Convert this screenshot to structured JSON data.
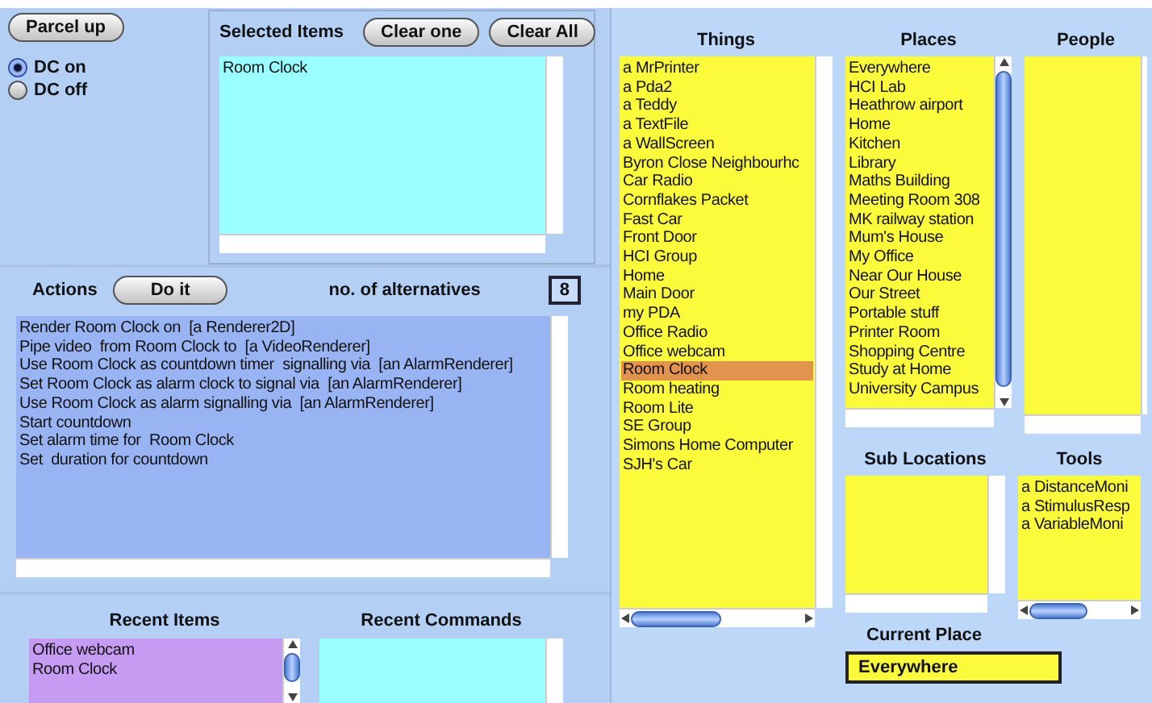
{
  "toolbar": {
    "parcel_button": "Parcel up",
    "dc_options": [
      {
        "label": "DC on",
        "selected": true
      },
      {
        "label": "DC off",
        "selected": false
      }
    ]
  },
  "selected_items": {
    "title": "Selected Items",
    "buttons": [
      "Clear one",
      "Clear All"
    ],
    "items": [
      {
        "label": "Room Clock",
        "selected": false
      }
    ]
  },
  "actions": {
    "title": "Actions",
    "do_button": "Do it",
    "alternatives_label": "no. of alternatives",
    "alternatives_count": "8",
    "items": [
      {
        "label": "Render Room Clock on  [a Renderer2D]",
        "selected": false
      },
      {
        "label": "Pipe video  from Room Clock to  [a VideoRenderer]",
        "selected": false
      },
      {
        "label": "Use Room Clock as countdown timer  signalling via  [an AlarmRenderer]",
        "selected": false
      },
      {
        "label": "Set Room Clock as alarm clock to signal via  [an AlarmRenderer]",
        "selected": false
      },
      {
        "label": "Use Room Clock as alarm signalling via  [an AlarmRenderer]",
        "selected": false
      },
      {
        "label": "Start countdown",
        "selected": false
      },
      {
        "label": "Set alarm time for  Room Clock",
        "selected": false
      },
      {
        "label": "Set  duration for countdown",
        "selected": false
      }
    ]
  },
  "recent_items": {
    "title": "Recent Items",
    "items": [
      {
        "label": "Office webcam",
        "selected": false
      },
      {
        "label": "Room Clock",
        "selected": false
      }
    ]
  },
  "recent_commands": {
    "title": "Recent Commands"
  },
  "things": {
    "title": "Things",
    "items": [
      {
        "label": "a MrPrinter",
        "selected": false
      },
      {
        "label": "a Pda2",
        "selected": false
      },
      {
        "label": "a Teddy",
        "selected": false
      },
      {
        "label": "a TextFile",
        "selected": false
      },
      {
        "label": "a WallScreen",
        "selected": false
      },
      {
        "label": "Byron Close Neighbourhc",
        "selected": false
      },
      {
        "label": "Car Radio",
        "selected": false
      },
      {
        "label": "Cornflakes Packet",
        "selected": false
      },
      {
        "label": "Fast Car",
        "selected": false
      },
      {
        "label": "Front Door",
        "selected": false
      },
      {
        "label": "HCI Group",
        "selected": false
      },
      {
        "label": "Home",
        "selected": false
      },
      {
        "label": "Main Door",
        "selected": false
      },
      {
        "label": "my PDA",
        "selected": false
      },
      {
        "label": "Office Radio",
        "selected": false
      },
      {
        "label": "Office webcam",
        "selected": false
      },
      {
        "label": "Room Clock",
        "selected": true
      },
      {
        "label": "Room heating",
        "selected": false
      },
      {
        "label": "Room Lite",
        "selected": false
      },
      {
        "label": "SE Group",
        "selected": false
      },
      {
        "label": "Simons Home Computer",
        "selected": false
      },
      {
        "label": "SJH's Car",
        "selected": false
      }
    ]
  },
  "places": {
    "title": "Places",
    "items": [
      {
        "label": "Everywhere",
        "selected": false
      },
      {
        "label": "HCI Lab",
        "selected": false
      },
      {
        "label": "Heathrow airport",
        "selected": false
      },
      {
        "label": "Home",
        "selected": false
      },
      {
        "label": "Kitchen",
        "selected": false
      },
      {
        "label": "Library",
        "selected": false
      },
      {
        "label": "Maths Building",
        "selected": false
      },
      {
        "label": "Meeting Room 308",
        "selected": false
      },
      {
        "label": "MK railway station",
        "selected": false
      },
      {
        "label": "Mum's House",
        "selected": false
      },
      {
        "label": "My Office",
        "selected": false
      },
      {
        "label": "Near Our House",
        "selected": false
      },
      {
        "label": "Our Street",
        "selected": false
      },
      {
        "label": "Portable stuff",
        "selected": false
      },
      {
        "label": "Printer Room",
        "selected": false
      },
      {
        "label": "Shopping Centre",
        "selected": false
      },
      {
        "label": "Study at Home",
        "selected": false
      },
      {
        "label": "University Campus",
        "selected": false
      }
    ]
  },
  "people": {
    "title": "People"
  },
  "sub_locations": {
    "title": "Sub Locations"
  },
  "tools": {
    "title": "Tools",
    "items": [
      {
        "label": "a DistanceMoni",
        "selected": false
      },
      {
        "label": "a StimulusResp",
        "selected": false
      },
      {
        "label": "a VariableMoni",
        "selected": false
      }
    ]
  },
  "current_place": {
    "label": "Current Place",
    "value": "Everywhere"
  }
}
